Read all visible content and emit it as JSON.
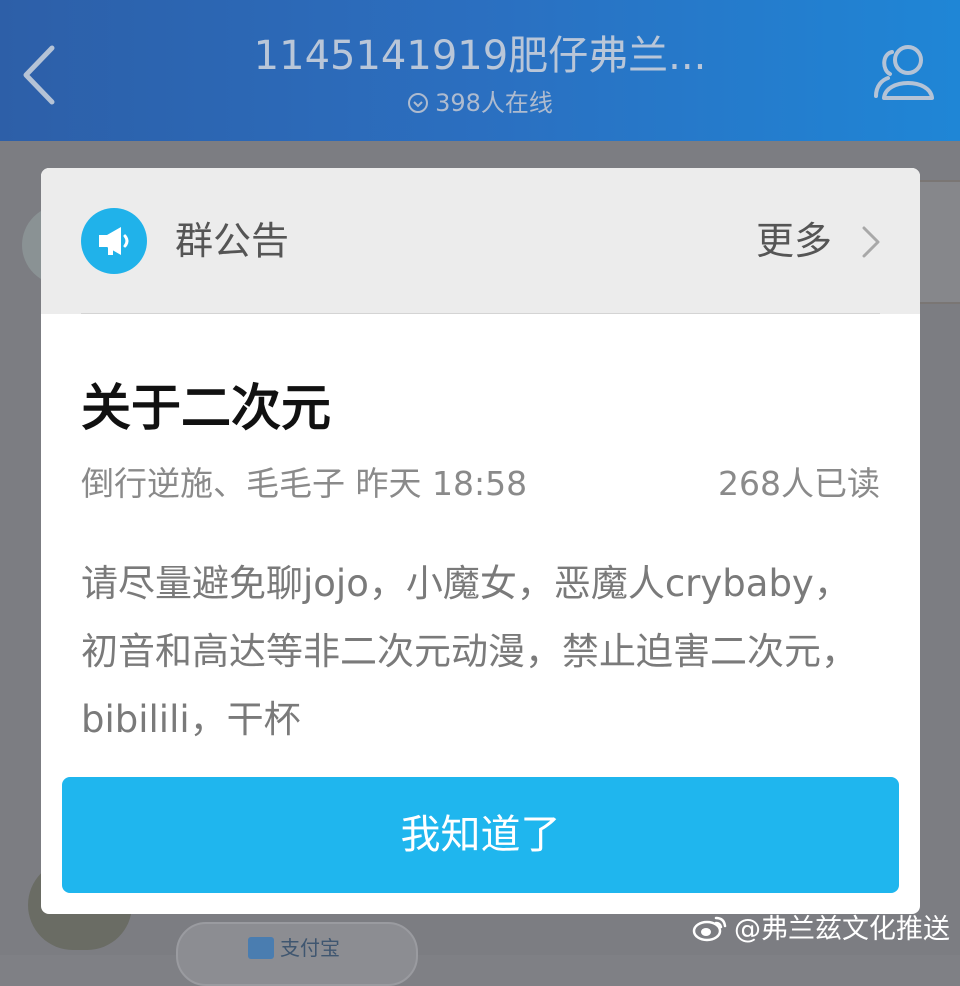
{
  "header": {
    "title": "1145141919肥仔弗兰...",
    "online": "398人在线"
  },
  "background": {
    "pill_text": "支付宝"
  },
  "announcement": {
    "header_label": "群公告",
    "more_label": "更多",
    "title": "关于二次元",
    "meta": "倒行逆施、毛毛子 昨天 18:58",
    "reads": "268人已读",
    "body": "请尽量避免聊jojo，小魔女，恶魔人crybaby，初音和高达等非二次元动漫，禁止迫害二次元，bibilili，干杯",
    "confirm_button": "我知道了"
  },
  "watermark": {
    "text": "@弗兰兹文化推送"
  },
  "icons": {
    "back": "chevron-left-icon",
    "profile": "group-members-icon",
    "online": "clock-icon",
    "announcement": "megaphone-icon",
    "more": "chevron-right-icon",
    "watermark": "weibo-icon"
  },
  "colors": {
    "header_start": "#2d5fa8",
    "header_end": "#1f86d6",
    "accent": "#1fb6ee",
    "dim_overlay": "#7c7d82"
  }
}
